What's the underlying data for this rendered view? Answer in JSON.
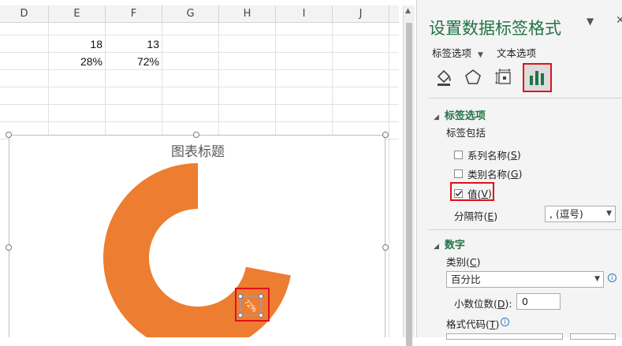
{
  "sheet": {
    "columns": [
      "D",
      "E",
      "F",
      "G",
      "H",
      "I",
      "J"
    ],
    "rows": [
      {
        "E": "18",
        "F": "13"
      },
      {
        "E": "28%",
        "F": "72%"
      }
    ]
  },
  "chart": {
    "title": "图表标题",
    "data_label": "72%",
    "colors": {
      "series": "#ED7D31"
    }
  },
  "chart_data": {
    "type": "pie",
    "subtype": "doughnut",
    "title": "图表标题",
    "values": [
      28,
      72
    ],
    "labels": [
      "28%",
      "72%"
    ],
    "visible_data_labels": [
      "72%"
    ],
    "colors": [
      "#FFFFFF",
      "#ED7D31"
    ]
  },
  "pane": {
    "title": "设置数据标签格式",
    "tabs": {
      "label_options": "标签选项",
      "text_options": "文本选项"
    },
    "icons": [
      "fill-line-icon",
      "effects-pentagon-icon",
      "size-properties-icon",
      "label-options-bar-icon"
    ],
    "sections": {
      "label_options": {
        "header": "标签选项",
        "contains_label": "标签包括",
        "series_name": {
          "prefix": "系列名称(",
          "key": "S",
          "suffix": ")",
          "checked": false
        },
        "category_name": {
          "prefix": "类别名称(",
          "key": "G",
          "suffix": ")",
          "checked": false
        },
        "value": {
          "prefix": "值(",
          "key": "V",
          "suffix": ")",
          "checked": true
        },
        "separator_label": {
          "prefix": "分隔符(",
          "key": "E",
          "suffix": ")"
        },
        "separator_value": ", (逗号)"
      },
      "number": {
        "header": "数字",
        "category_label": {
          "prefix": "类别(",
          "key": "C",
          "suffix": ")"
        },
        "category_value": "百分比",
        "decimals_label": {
          "prefix": "小数位数(",
          "key": "D",
          "suffix": "):"
        },
        "decimals_value": "0",
        "format_code_label": {
          "prefix": "格式代码(",
          "key": "T",
          "suffix": ")"
        }
      }
    },
    "colors": {
      "accent": "#217346",
      "highlight": "#E2101B"
    }
  }
}
